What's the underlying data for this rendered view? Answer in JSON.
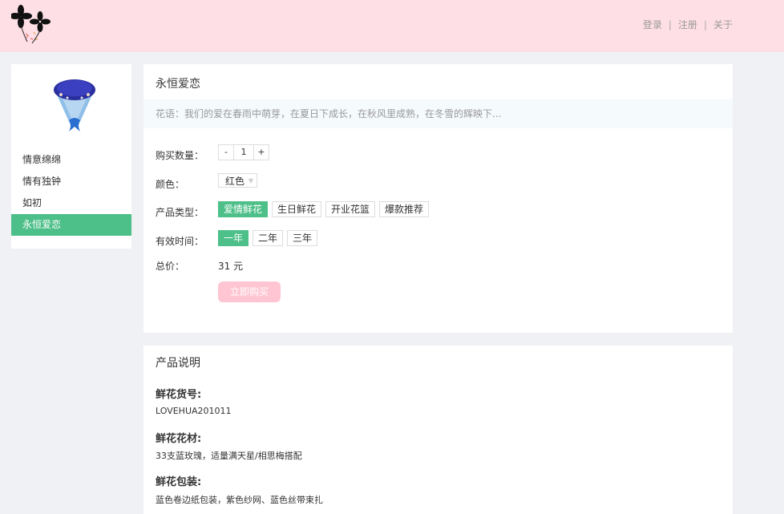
{
  "header": {
    "nav": {
      "login": "登录",
      "register": "注册",
      "about": "关于",
      "sep": "|"
    }
  },
  "sidebar": {
    "items": [
      {
        "label": "情意绵绵"
      },
      {
        "label": "情有独钟"
      },
      {
        "label": "如初"
      },
      {
        "label": "永恒爱恋"
      }
    ],
    "active_index": 3
  },
  "product": {
    "title": "永恒爱恋",
    "slogan": "花语：我们的爱在春雨中萌芽，在夏日下成长，在秋风里成熟，在冬雪的辉映下...",
    "quantity": {
      "label": "购买数量：",
      "minus": "-",
      "value": "1",
      "plus": "+"
    },
    "color": {
      "label": "颜色：",
      "value": "红色"
    },
    "type": {
      "label": "产品类型：",
      "options": [
        "爱情鲜花",
        "生日鲜花",
        "开业花篮",
        "爆款推荐"
      ],
      "selected": "爱情鲜花"
    },
    "validity": {
      "label": "有效时间：",
      "options": [
        "一年",
        "二年",
        "三年"
      ],
      "selected": "一年"
    },
    "total": {
      "label": "总价：",
      "value": "31 元"
    },
    "buy_label": "立即购买"
  },
  "description": {
    "title": "产品说明",
    "sections": [
      {
        "heading": "鲜花货号:",
        "text": "LOVEHUA201011"
      },
      {
        "heading": "鲜花花材:",
        "text": "33支蓝玫瑰，适量满天星/相思梅搭配"
      },
      {
        "heading": "鲜花包装:",
        "text": "蓝色卷边纸包装，紫色纱网、蓝色丝带束扎"
      }
    ]
  },
  "colors": {
    "header_bg": "#ffdfe6",
    "accent_green": "#4dbf88",
    "buy_button": "#ffc5d2",
    "page_bg": "#f0f1f5"
  }
}
